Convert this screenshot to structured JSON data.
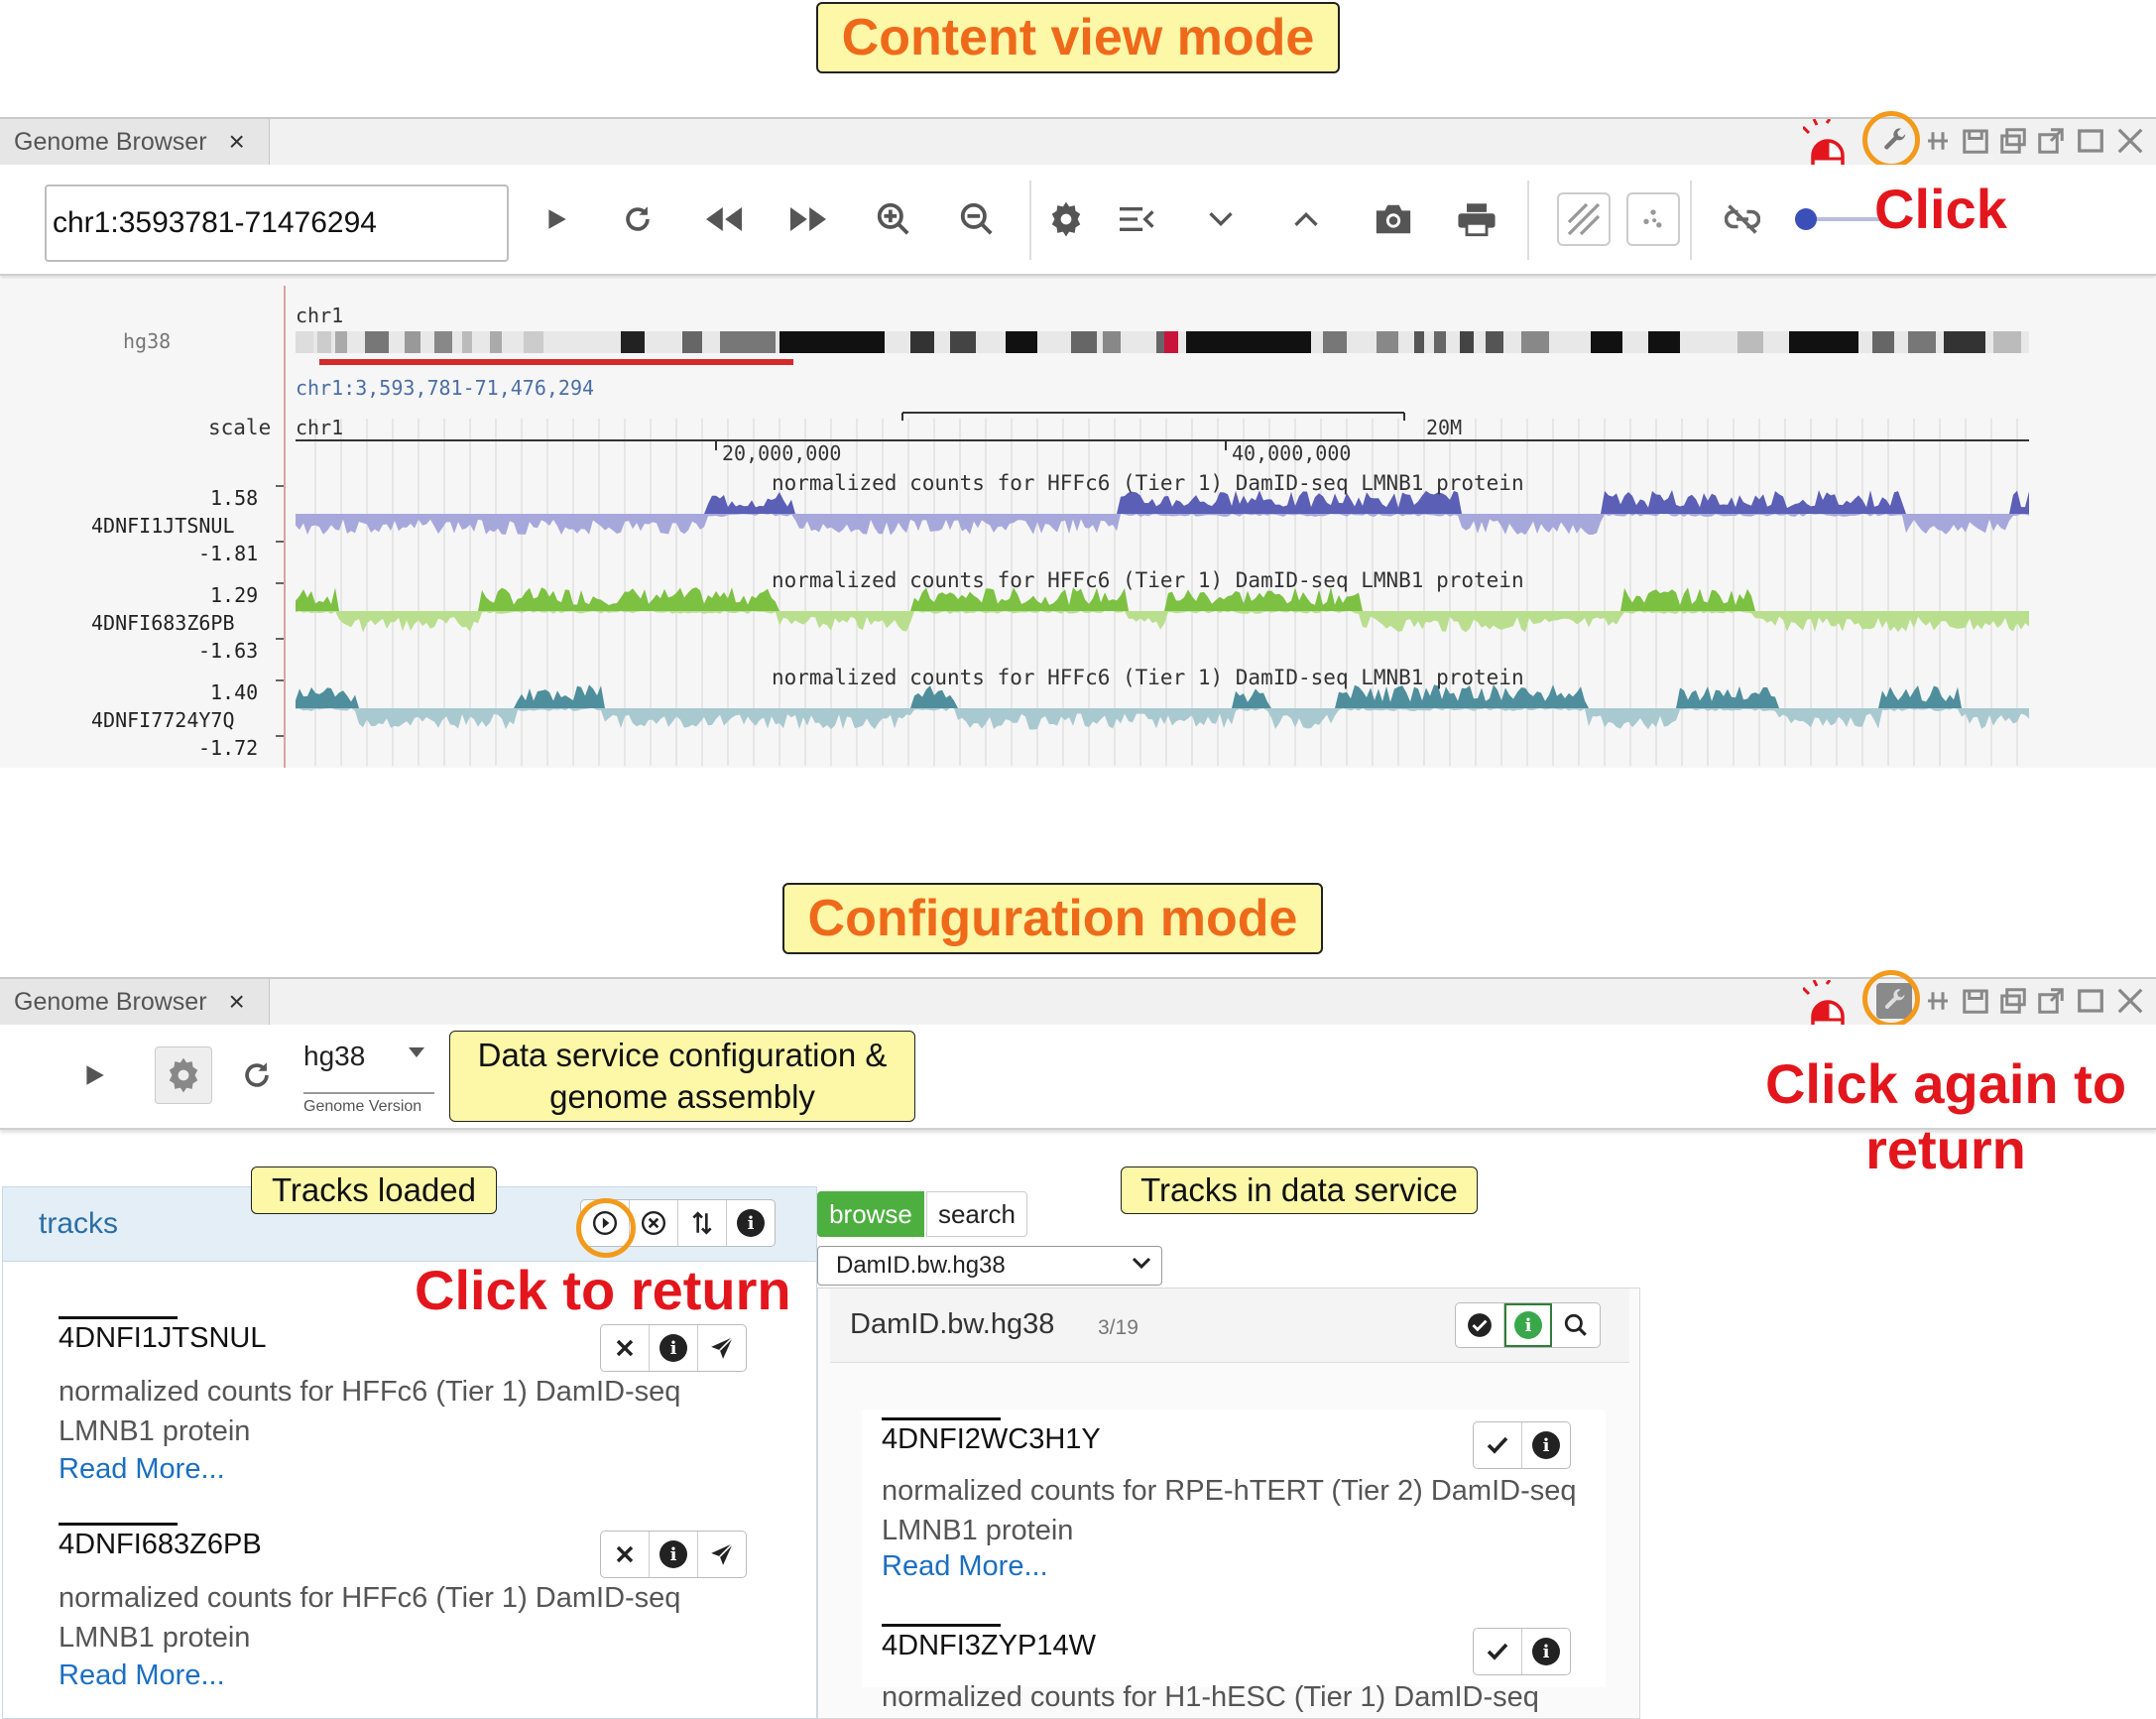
{
  "callouts": {
    "content_view": "Content view mode",
    "configuration": "Configuration mode",
    "data_service": "Data service configuration & genome assembly",
    "tracks_loaded": "Tracks loaded",
    "tracks_in_service": "Tracks in data service"
  },
  "annotations": {
    "click": "Click",
    "click_again": "Click again to return",
    "click_to_return": "Click to return"
  },
  "window": {
    "tab_label": "Genome Browser",
    "tab_close": "×"
  },
  "content_view": {
    "location": "chr1:3593781-71476294",
    "genome": "hg38",
    "chrom": "chr1",
    "region_label": "chr1:3,593,781-71,476,294",
    "scale_label": "scale",
    "scale_chrom": "chr1",
    "scale_bar_label": "20M",
    "ticks": [
      "20,000,000",
      "40,000,000"
    ],
    "tracks": [
      {
        "id": "4DNFI1JTSNUL",
        "max": "1.58",
        "min": "-1.81",
        "title": "normalized counts for HFFc6 (Tier 1) DamID-seq LMNB1 protein",
        "color": "#5b5fb6",
        "fill": "#a6a8dc",
        "seed": 3
      },
      {
        "id": "4DNFI683Z6PB",
        "max": "1.29",
        "min": "-1.63",
        "title": "normalized counts for HFFc6 (Tier 1) DamID-seq LMNB1 protein",
        "color": "#7cc142",
        "fill": "#b9df8e",
        "seed": 7
      },
      {
        "id": "4DNFI7724Y7Q",
        "max": "1.40",
        "min": "-1.72",
        "title": "normalized counts for HFFc6 (Tier 1) DamID-seq LMNB1 protein",
        "color": "#4f8e9c",
        "fill": "#a9c9d0",
        "seed": 11
      }
    ]
  },
  "config_view": {
    "genome_select": "hg38",
    "genome_caption": "Genome Version",
    "tracks_header": "tracks",
    "browse_tab": "browse",
    "search_tab": "search",
    "service_select": "DamID.bw.hg38",
    "service_header": "DamID.bw.hg38",
    "service_count": "3/19",
    "loaded_tracks": [
      {
        "id": "4DNFI1JTSNUL",
        "desc_line1": "normalized counts for HFFc6 (Tier 1) DamID-seq",
        "desc_line2": "LMNB1 protein",
        "read_more": "Read More..."
      },
      {
        "id": "4DNFI683Z6PB",
        "desc_line1": "normalized counts for HFFc6 (Tier 1) DamID-seq",
        "desc_line2": "LMNB1 protein",
        "read_more": "Read More..."
      }
    ],
    "service_tracks": [
      {
        "id": "4DNFI2WC3H1Y",
        "desc_line1": "normalized counts for RPE-hTERT (Tier 2) DamID-seq",
        "desc_line2": "LMNB1 protein",
        "read_more": "Read More..."
      },
      {
        "id": "4DNFI3ZYP14W",
        "desc_line1": "normalized counts for H1-hESC (Tier 1) DamID-seq"
      }
    ]
  },
  "colors": {
    "callout_bg": "#fdf7a8",
    "callout_title": "#ee6a1a",
    "annotation_red": "#e2161c",
    "highlight_ring": "#f29a1c",
    "browse_green": "#4caf3f",
    "link_blue": "#1b6fc2"
  }
}
